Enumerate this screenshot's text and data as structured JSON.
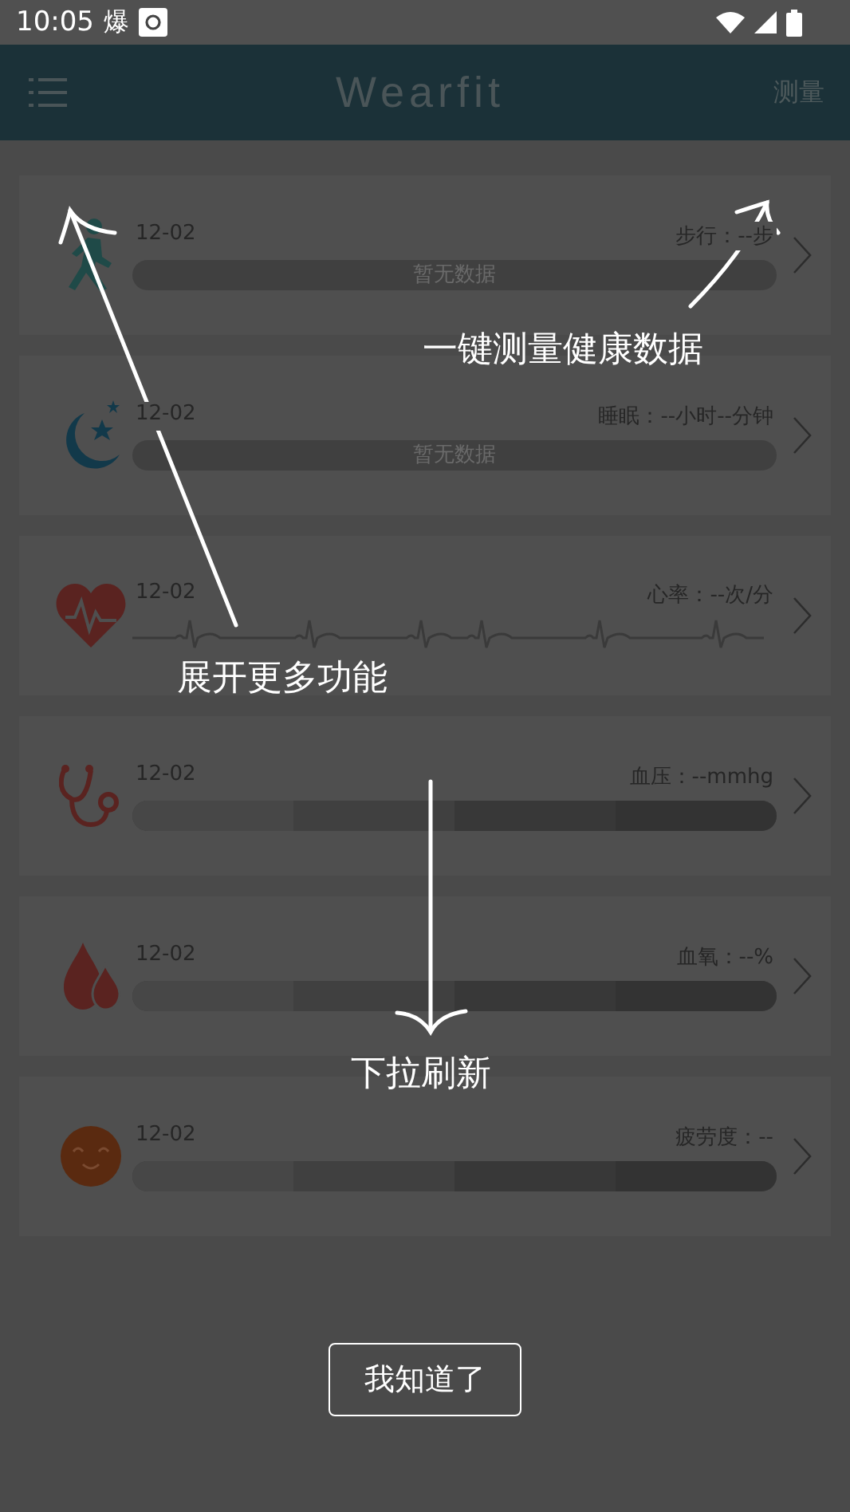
{
  "status_bar": {
    "time": "10:05",
    "notification": "爆"
  },
  "header": {
    "title": "Wearfit",
    "action": "测量"
  },
  "cards": [
    {
      "kind": "empty",
      "date": "12-02",
      "reading": "步行：--步",
      "bar_text": "暂无数据"
    },
    {
      "kind": "empty",
      "date": "12-02",
      "reading": "睡眠：--小时--分钟",
      "bar_text": "暂无数据"
    },
    {
      "kind": "ecg",
      "date": "12-02",
      "reading": "心率：--次/分"
    },
    {
      "kind": "segments",
      "date": "12-02",
      "reading": "血压：--mmhg"
    },
    {
      "kind": "segments",
      "date": "12-02",
      "reading": "血氧：--%"
    },
    {
      "kind": "segments",
      "date": "12-02",
      "reading": "疲劳度：--"
    }
  ],
  "hints": [
    {
      "kind": "measure",
      "text": "一键测量健康数据"
    },
    {
      "kind": "menu",
      "text": "展开更多功能"
    },
    {
      "kind": "refresh",
      "text": "下拉刷新"
    }
  ],
  "dismiss_button": "我知道了"
}
